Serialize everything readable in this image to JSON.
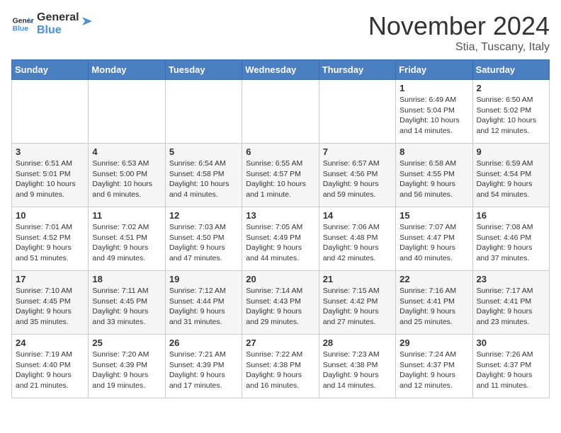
{
  "logo": {
    "text_general": "General",
    "text_blue": "Blue"
  },
  "header": {
    "month_title": "November 2024",
    "location": "Stia, Tuscany, Italy"
  },
  "days_of_week": [
    "Sunday",
    "Monday",
    "Tuesday",
    "Wednesday",
    "Thursday",
    "Friday",
    "Saturday"
  ],
  "weeks": [
    [
      {
        "day": "",
        "info": ""
      },
      {
        "day": "",
        "info": ""
      },
      {
        "day": "",
        "info": ""
      },
      {
        "day": "",
        "info": ""
      },
      {
        "day": "",
        "info": ""
      },
      {
        "day": "1",
        "info": "Sunrise: 6:49 AM\nSunset: 5:04 PM\nDaylight: 10 hours and 14 minutes."
      },
      {
        "day": "2",
        "info": "Sunrise: 6:50 AM\nSunset: 5:02 PM\nDaylight: 10 hours and 12 minutes."
      }
    ],
    [
      {
        "day": "3",
        "info": "Sunrise: 6:51 AM\nSunset: 5:01 PM\nDaylight: 10 hours and 9 minutes."
      },
      {
        "day": "4",
        "info": "Sunrise: 6:53 AM\nSunset: 5:00 PM\nDaylight: 10 hours and 6 minutes."
      },
      {
        "day": "5",
        "info": "Sunrise: 6:54 AM\nSunset: 4:58 PM\nDaylight: 10 hours and 4 minutes."
      },
      {
        "day": "6",
        "info": "Sunrise: 6:55 AM\nSunset: 4:57 PM\nDaylight: 10 hours and 1 minute."
      },
      {
        "day": "7",
        "info": "Sunrise: 6:57 AM\nSunset: 4:56 PM\nDaylight: 9 hours and 59 minutes."
      },
      {
        "day": "8",
        "info": "Sunrise: 6:58 AM\nSunset: 4:55 PM\nDaylight: 9 hours and 56 minutes."
      },
      {
        "day": "9",
        "info": "Sunrise: 6:59 AM\nSunset: 4:54 PM\nDaylight: 9 hours and 54 minutes."
      }
    ],
    [
      {
        "day": "10",
        "info": "Sunrise: 7:01 AM\nSunset: 4:52 PM\nDaylight: 9 hours and 51 minutes."
      },
      {
        "day": "11",
        "info": "Sunrise: 7:02 AM\nSunset: 4:51 PM\nDaylight: 9 hours and 49 minutes."
      },
      {
        "day": "12",
        "info": "Sunrise: 7:03 AM\nSunset: 4:50 PM\nDaylight: 9 hours and 47 minutes."
      },
      {
        "day": "13",
        "info": "Sunrise: 7:05 AM\nSunset: 4:49 PM\nDaylight: 9 hours and 44 minutes."
      },
      {
        "day": "14",
        "info": "Sunrise: 7:06 AM\nSunset: 4:48 PM\nDaylight: 9 hours and 42 minutes."
      },
      {
        "day": "15",
        "info": "Sunrise: 7:07 AM\nSunset: 4:47 PM\nDaylight: 9 hours and 40 minutes."
      },
      {
        "day": "16",
        "info": "Sunrise: 7:08 AM\nSunset: 4:46 PM\nDaylight: 9 hours and 37 minutes."
      }
    ],
    [
      {
        "day": "17",
        "info": "Sunrise: 7:10 AM\nSunset: 4:45 PM\nDaylight: 9 hours and 35 minutes."
      },
      {
        "day": "18",
        "info": "Sunrise: 7:11 AM\nSunset: 4:45 PM\nDaylight: 9 hours and 33 minutes."
      },
      {
        "day": "19",
        "info": "Sunrise: 7:12 AM\nSunset: 4:44 PM\nDaylight: 9 hours and 31 minutes."
      },
      {
        "day": "20",
        "info": "Sunrise: 7:14 AM\nSunset: 4:43 PM\nDaylight: 9 hours and 29 minutes."
      },
      {
        "day": "21",
        "info": "Sunrise: 7:15 AM\nSunset: 4:42 PM\nDaylight: 9 hours and 27 minutes."
      },
      {
        "day": "22",
        "info": "Sunrise: 7:16 AM\nSunset: 4:41 PM\nDaylight: 9 hours and 25 minutes."
      },
      {
        "day": "23",
        "info": "Sunrise: 7:17 AM\nSunset: 4:41 PM\nDaylight: 9 hours and 23 minutes."
      }
    ],
    [
      {
        "day": "24",
        "info": "Sunrise: 7:19 AM\nSunset: 4:40 PM\nDaylight: 9 hours and 21 minutes."
      },
      {
        "day": "25",
        "info": "Sunrise: 7:20 AM\nSunset: 4:39 PM\nDaylight: 9 hours and 19 minutes."
      },
      {
        "day": "26",
        "info": "Sunrise: 7:21 AM\nSunset: 4:39 PM\nDaylight: 9 hours and 17 minutes."
      },
      {
        "day": "27",
        "info": "Sunrise: 7:22 AM\nSunset: 4:38 PM\nDaylight: 9 hours and 16 minutes."
      },
      {
        "day": "28",
        "info": "Sunrise: 7:23 AM\nSunset: 4:38 PM\nDaylight: 9 hours and 14 minutes."
      },
      {
        "day": "29",
        "info": "Sunrise: 7:24 AM\nSunset: 4:37 PM\nDaylight: 9 hours and 12 minutes."
      },
      {
        "day": "30",
        "info": "Sunrise: 7:26 AM\nSunset: 4:37 PM\nDaylight: 9 hours and 11 minutes."
      }
    ]
  ]
}
